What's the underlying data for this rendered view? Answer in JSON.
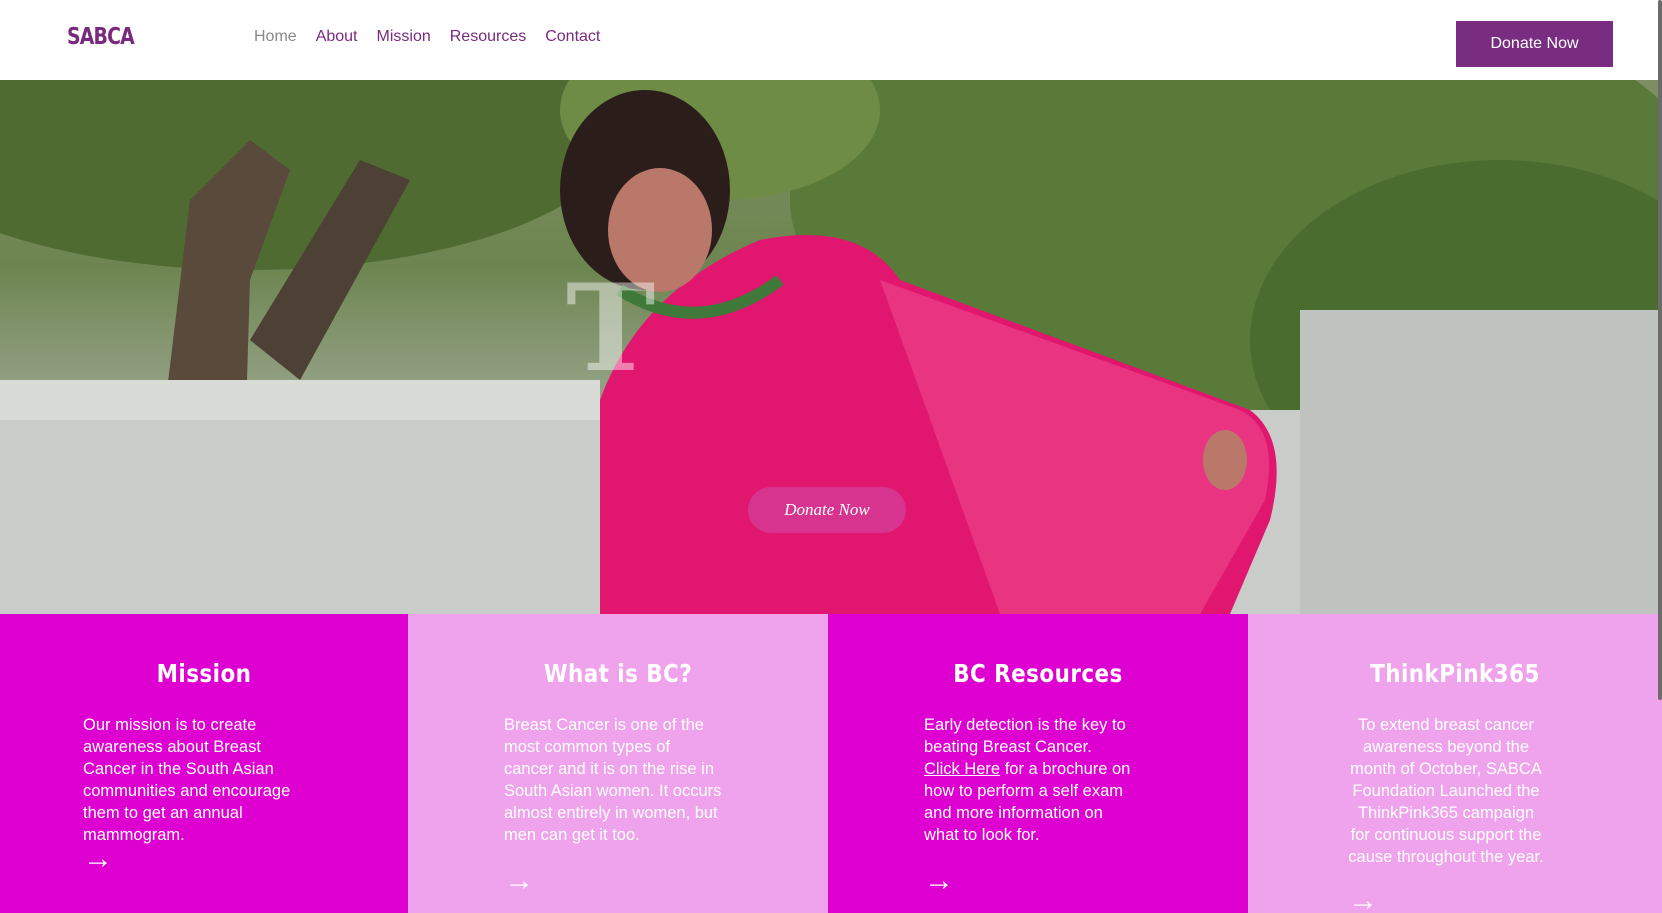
{
  "header": {
    "logo": "SABCA",
    "nav": [
      "Home",
      "About",
      "Mission",
      "Resources",
      "Contact"
    ],
    "donate_label": "Donate Now"
  },
  "hero": {
    "overlay_text": "T",
    "donate_label": "Donate Now"
  },
  "cards": [
    {
      "title": "Mission",
      "text": "Our mission is to create awareness about Breast Cancer in the South Asian communities and encourage them to get an annual mammogram.",
      "arrow": "→"
    },
    {
      "title": "What is BC?",
      "text": "Breast Cancer is one of the most common types of cancer and it is on the rise in South Asian women. It occurs almost entirely in women, but men can get it too.",
      "arrow": "→"
    },
    {
      "title": "BC Resources",
      "text_before": "Early detection is the key to beating Breast Cancer. ",
      "link": "Click Here",
      "text_after": " for a brochure on how to perform a self exam and more information on what to look for.",
      "arrow": "→"
    },
    {
      "title": "ThinkPink365",
      "text": "To extend breast cancer awareness beyond the month of October, SABCA Foundation Launched the ThinkPink365 campaign for continuous support the cause throughout the year.",
      "arrow": "→"
    }
  ],
  "colors": {
    "brand_purple": "#782d80",
    "card_dark": "#de00d0",
    "card_light": "#efa3ec",
    "hero_button": "#d6348f"
  }
}
